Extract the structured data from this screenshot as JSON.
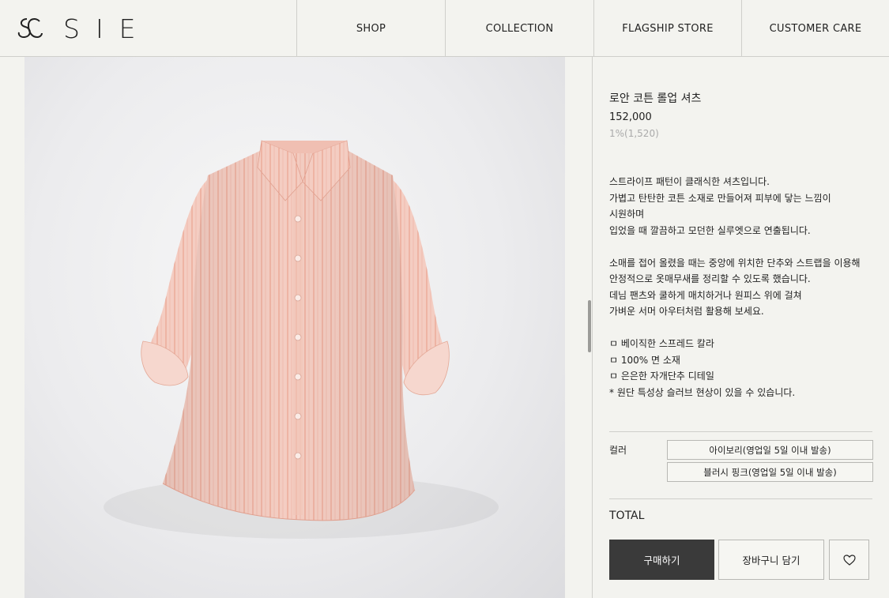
{
  "header": {
    "logo_text": "SIE",
    "nav": [
      "SHOP",
      "COLLECTION",
      "FLAGSHIP STORE",
      "CUSTOMER CARE"
    ]
  },
  "product": {
    "title": "로안 코튼 롤업 셔츠",
    "price": "152,000",
    "points": "1%(1,520)",
    "description": [
      "스트라이프 패턴이 클래식한 셔츠입니다.",
      "가볍고 탄탄한 코튼 소재로 만들어져 피부에 닿는 느낌이",
      "시원하며",
      "입었을 때 깔끔하고 모던한 실루엣으로 연출됩니다.",
      "",
      "소매를 접어 올렸을 때는 중앙에 위치한 단추와 스트랩을 이용해",
      "안정적으로 옷매무새를 정리할 수 있도록 했습니다.",
      "데님 팬츠와 쿨하게 매치하거나 원피스 위에 걸쳐",
      "가벼운 서머 아우터처럼 활용해 보세요.",
      "",
      "ㅁ 베이직한 스프레드 칼라",
      "ㅁ 100% 면 소재",
      "ㅁ 은은한 자개단추 디테일",
      "* 원단 특성상 슬러브 현상이 있을 수 있습니다."
    ],
    "color_label": "컬러",
    "color_options": [
      "아이보리(영업일 5일 이내 발송)",
      "블러시 핑크(영업일 5일 이내 발송)"
    ],
    "total_label": "TOTAL",
    "buy_label": "구매하기",
    "cart_label": "장바구니 담기",
    "colors": {
      "shirt": "#f4cdc2",
      "stripe": "#e89a86",
      "button_dark": "#3a3a3a"
    }
  }
}
